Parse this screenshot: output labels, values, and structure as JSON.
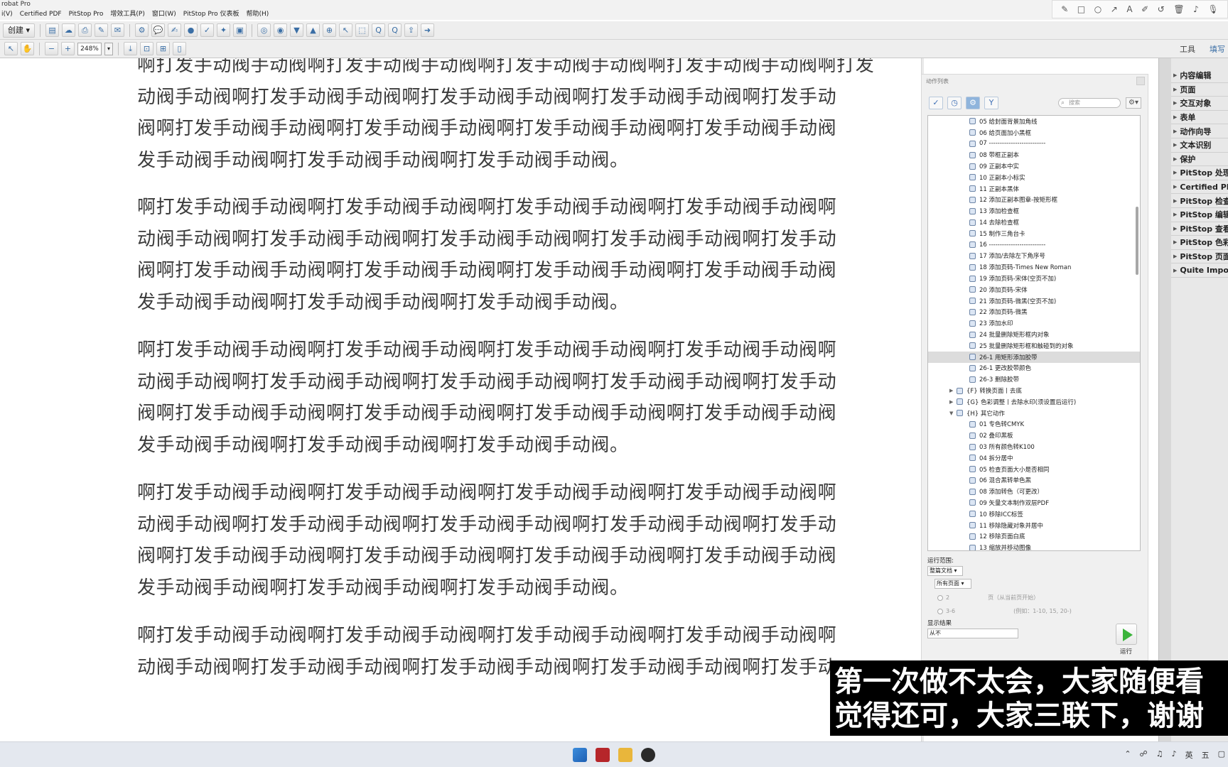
{
  "app": {
    "title": "robat Pro"
  },
  "menu": [
    "i(V)",
    "Certified PDF",
    "PitStop Pro",
    "增效工具(P)",
    "窗口(W)",
    "PitStop Pro 仪表板",
    "帮助(H)"
  ],
  "toolbar": {
    "create_label": "创建 ▾",
    "zoom": "248%",
    "tools_label": "工具",
    "share_label": "填写"
  },
  "document": {
    "paragraphs": [
      "啊打发手动阀手动阀啊打发手动阀手动阀啊打发手动阀手动阀啊打发手动阀手动阀啊打发\n动阀手动阀啊打发手动阀手动阀啊打发手动阀手动阀啊打发手动阀手动阀啊打发手动\n阀啊打发手动阀手动阀啊打发手动阀手动阀啊打发手动阀手动阀啊打发手动阀手动阀\n发手动阀手动阀啊打发手动阀手动阀啊打发手动阀手动阀。",
      "啊打发手动阀手动阀啊打发手动阀手动阀啊打发手动阀手动阀啊打发手动阀手动阀啊\n动阀手动阀啊打发手动阀手动阀啊打发手动阀手动阀啊打发手动阀手动阀啊打发手动\n阀啊打发手动阀手动阀啊打发手动阀手动阀啊打发手动阀手动阀啊打发手动阀手动阀\n发手动阀手动阀啊打发手动阀手动阀啊打发手动阀手动阀。",
      "啊打发手动阀手动阀啊打发手动阀手动阀啊打发手动阀手动阀啊打发手动阀手动阀啊\n动阀手动阀啊打发手动阀手动阀啊打发手动阀手动阀啊打发手动阀手动阀啊打发手动\n阀啊打发手动阀手动阀啊打发手动阀手动阀啊打发手动阀手动阀啊打发手动阀手动阀\n发手动阀手动阀啊打发手动阀手动阀啊打发手动阀手动阀。",
      "啊打发手动阀手动阀啊打发手动阀手动阀啊打发手动阀手动阀啊打发手动阀手动阀啊\n动阀手动阀啊打发手动阀手动阀啊打发手动阀手动阀啊打发手动阀手动阀啊打发手动\n阀啊打发手动阀手动阀啊打发手动阀手动阀啊打发手动阀手动阀啊打发手动阀手动阀\n发手动阀手动阀啊打发手动阀手动阀啊打发手动阀手动阀。",
      "啊打发手动阀手动阀啊打发手动阀手动阀啊打发手动阀手动阀啊打发手动阀手动阀啊\n动阀手动阀啊打发手动阀手动阀啊打发手动阀手动阀啊打发手动阀手动阀啊打发手动"
    ]
  },
  "action_panel": {
    "title": "动作列表",
    "search_placeholder": "搜索",
    "tree": [
      {
        "label": "05 给封面背景加角线",
        "depth": 2
      },
      {
        "label": "06 给页面加小黑框",
        "depth": 2
      },
      {
        "label": "07 --------------------------",
        "depth": 2
      },
      {
        "label": "08 带框正副本",
        "depth": 2
      },
      {
        "label": "09 正副本中实",
        "depth": 2
      },
      {
        "label": "10 正副本小标实",
        "depth": 2
      },
      {
        "label": "11 正副本黑体",
        "depth": 2
      },
      {
        "label": "12 添加正副本图章-按矩形框",
        "depth": 2
      },
      {
        "label": "13 添加检查框",
        "depth": 2
      },
      {
        "label": "14 去除检查框",
        "depth": 2
      },
      {
        "label": "15 制作三角台卡",
        "depth": 2
      },
      {
        "label": "16 --------------------------",
        "depth": 2
      },
      {
        "label": "17 添加/去除左下角序号",
        "depth": 2
      },
      {
        "label": "18 添加页码-Times New Roman",
        "depth": 2
      },
      {
        "label": "19 添加页码-宋体(空页不加)",
        "depth": 2
      },
      {
        "label": "20 添加页码-宋体",
        "depth": 2
      },
      {
        "label": "21 添加页码-微黑(空页不加)",
        "depth": 2
      },
      {
        "label": "22 添加页码-微黑",
        "depth": 2
      },
      {
        "label": "23 添加水印",
        "depth": 2
      },
      {
        "label": "24 批量删除矩形框内对象",
        "depth": 2
      },
      {
        "label": "25 批量删除矩形框和触碰到的对象",
        "depth": 2
      },
      {
        "label": "26-1 用矩形添加胶带",
        "depth": 2,
        "selected": true
      },
      {
        "label": "26-1 更改胶带颜色",
        "depth": 2
      },
      {
        "label": "26-3 删除胶带",
        "depth": 2
      },
      {
        "label": "{F} 转换页面丨去底",
        "depth": 1,
        "arrow": "▶"
      },
      {
        "label": "{G} 色彩调整丨去除水印(须设置后运行)",
        "depth": 1,
        "arrow": "▶"
      },
      {
        "label": "{H} 其它动作",
        "depth": 1,
        "arrow": "▼"
      },
      {
        "label": "01 专色转CMYK",
        "depth": 2
      },
      {
        "label": "02 叠印黑板",
        "depth": 2
      },
      {
        "label": "03 所有颜色转K100",
        "depth": 2
      },
      {
        "label": "04 拆分居中",
        "depth": 2
      },
      {
        "label": "05 检查页面大小是否相同",
        "depth": 2
      },
      {
        "label": "06 混合黑转单色黑",
        "depth": 2
      },
      {
        "label": "08 添加转色（可更改）",
        "depth": 2
      },
      {
        "label": "09 矢量文本制作双层PDF",
        "depth": 2
      },
      {
        "label": "10 移除ICC标签",
        "depth": 2
      },
      {
        "label": "11 移除隐藏对象并居中",
        "depth": 2
      },
      {
        "label": "12 移除页面白底",
        "depth": 2
      },
      {
        "label": "13 缩放并移动图像",
        "depth": 2
      }
    ],
    "run_scope_label": "运行范围:",
    "scope_value": "整篇文档",
    "pages_value": "所有页面",
    "page_count_value": "2",
    "page_count_hint": "页（从当前页开始）",
    "range_value": "3-6",
    "range_hint": "(例如：1-10, 15, 20-)",
    "show_result_label": "显示结果",
    "result_value": "从不",
    "run_label": "运行"
  },
  "right_panel": {
    "items": [
      "内容编辑",
      "页面",
      "交互对象",
      "表单",
      "动作向导",
      "文本识别",
      "保护",
      "PitStop 处理",
      "Certified PDF",
      "PitStop 检查",
      "PitStop 编辑",
      "PitStop 查看",
      "PitStop 色彩",
      "PitStop 页面程",
      "Quite Imposing"
    ]
  },
  "subtitle": {
    "lines": [
      "第一次做不太会，大家随便看",
      "觉得还可，大家三联下，谢谢"
    ]
  },
  "taskbar": {
    "lang": "英",
    "ime": "五"
  }
}
